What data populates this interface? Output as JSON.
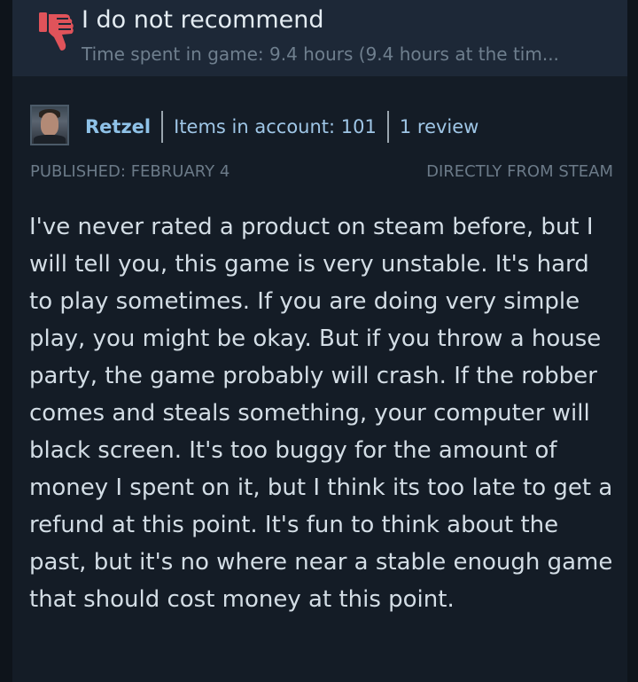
{
  "header": {
    "icon": "thumbs-down-icon",
    "icon_color": "#e0535a",
    "verdict": "I do not recommend",
    "playtime": "Time spent in game: 9.4 hours (9.4 hours at the tim..."
  },
  "author": {
    "username": "Retzel",
    "items_in_account": "Items in account: 101",
    "reviews": "1 review"
  },
  "meta": {
    "published": "PUBLISHED: FEBRUARY 4",
    "source": "DIRECTLY FROM STEAM"
  },
  "review": {
    "text": "I've never rated a product on steam before, but I will tell you, this game is very unstable. It's hard to play sometimes. If you are doing very simple play, you might be okay. But if you throw a house party, the game probably will crash. If the robber comes and steals something, your computer will black screen. It's too buggy for the amount of money I spent on it, but I think its too late to get a refund at this point. It's fun to think about the past, but it's no where near a stable enough game that should cost money at this point."
  },
  "colors": {
    "background": "#0e141b",
    "header_bg": "#1d2837",
    "panel_bg": "#141c26",
    "link_blue": "#8fc2e8"
  }
}
